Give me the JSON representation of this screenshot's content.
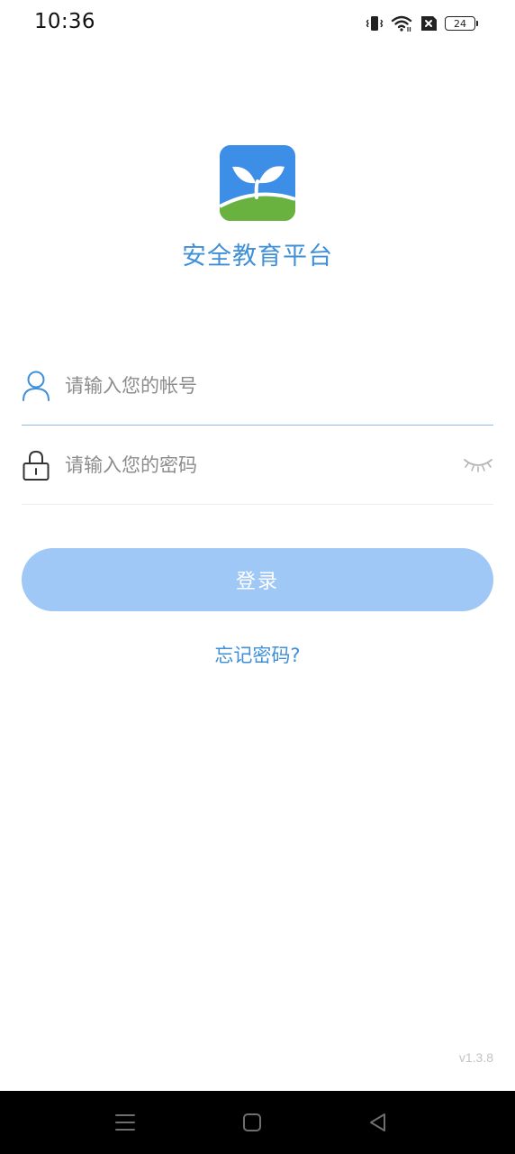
{
  "status_bar": {
    "time": "10:36",
    "battery_level": "24",
    "icons": [
      "vibrate-icon",
      "wifi-icon",
      "no-sim-icon",
      "battery-icon"
    ]
  },
  "app": {
    "title": "安全教育平台",
    "logo_icon": "sprout-logo-icon",
    "version": "v1.3.8"
  },
  "login_form": {
    "account_placeholder": "请输入您的帐号",
    "account_value": "",
    "password_placeholder": "请输入您的密码",
    "password_value": "",
    "login_label": "登录",
    "forgot_label": "忘记密码?"
  },
  "colors": {
    "accent": "#3f8fd9",
    "button": "#9fc8f6",
    "logo_blue": "#3d8ee6",
    "logo_green": "#6ab23f"
  },
  "nav_bar": {
    "icons": [
      "menu-icon",
      "home-icon",
      "back-icon"
    ]
  }
}
